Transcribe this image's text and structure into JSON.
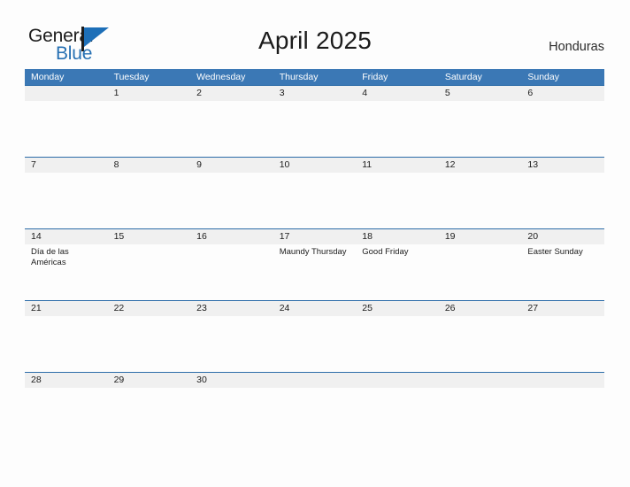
{
  "brand": {
    "name_part1": "General",
    "name_part2": "Blue",
    "flag_icon": "flag-triangle-icon",
    "accent_color": "#1d6fb8"
  },
  "header": {
    "title": "April 2025",
    "country": "Honduras"
  },
  "colors": {
    "weekday_header_bg": "#3b78b5",
    "weekday_header_text": "#ffffff",
    "daynum_band_bg": "#f0f0f0",
    "row_divider": "#2c6ca8",
    "page_bg": "#fdfdfd",
    "text": "#1c1c1c"
  },
  "calendar": {
    "weekdays": [
      "Monday",
      "Tuesday",
      "Wednesday",
      "Thursday",
      "Friday",
      "Saturday",
      "Sunday"
    ],
    "weeks": [
      [
        {
          "num": "",
          "event": ""
        },
        {
          "num": "1",
          "event": ""
        },
        {
          "num": "2",
          "event": ""
        },
        {
          "num": "3",
          "event": ""
        },
        {
          "num": "4",
          "event": ""
        },
        {
          "num": "5",
          "event": ""
        },
        {
          "num": "6",
          "event": ""
        }
      ],
      [
        {
          "num": "7",
          "event": ""
        },
        {
          "num": "8",
          "event": ""
        },
        {
          "num": "9",
          "event": ""
        },
        {
          "num": "10",
          "event": ""
        },
        {
          "num": "11",
          "event": ""
        },
        {
          "num": "12",
          "event": ""
        },
        {
          "num": "13",
          "event": ""
        }
      ],
      [
        {
          "num": "14",
          "event": "Día de las Américas"
        },
        {
          "num": "15",
          "event": ""
        },
        {
          "num": "16",
          "event": ""
        },
        {
          "num": "17",
          "event": "Maundy Thursday"
        },
        {
          "num": "18",
          "event": "Good Friday"
        },
        {
          "num": "19",
          "event": ""
        },
        {
          "num": "20",
          "event": "Easter Sunday"
        }
      ],
      [
        {
          "num": "21",
          "event": ""
        },
        {
          "num": "22",
          "event": ""
        },
        {
          "num": "23",
          "event": ""
        },
        {
          "num": "24",
          "event": ""
        },
        {
          "num": "25",
          "event": ""
        },
        {
          "num": "26",
          "event": ""
        },
        {
          "num": "27",
          "event": ""
        }
      ],
      [
        {
          "num": "28",
          "event": ""
        },
        {
          "num": "29",
          "event": ""
        },
        {
          "num": "30",
          "event": ""
        },
        {
          "num": "",
          "event": ""
        },
        {
          "num": "",
          "event": ""
        },
        {
          "num": "",
          "event": ""
        },
        {
          "num": "",
          "event": ""
        }
      ]
    ]
  }
}
